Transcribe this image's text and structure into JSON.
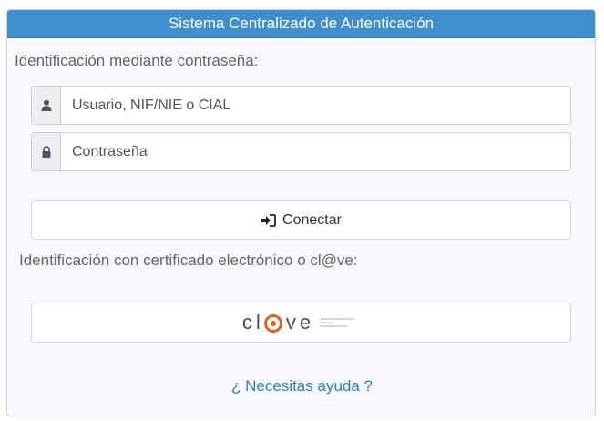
{
  "header": {
    "title": "Sistema Centralizado de Autenticación"
  },
  "password_section": {
    "label": "Identificación mediante contraseña:",
    "user_field": {
      "placeholder": "Usuario, NIF/NIE o CIAL",
      "value": "",
      "icon": "user-icon"
    },
    "password_field": {
      "placeholder": "Contraseña",
      "value": "",
      "icon": "lock-icon"
    },
    "connect_button": {
      "label": "Conectar",
      "icon": "sign-in-icon"
    }
  },
  "certificate_section": {
    "label": "Identificación con certificado electrónico o cl@ve:",
    "clave_logo": {
      "text_left": "cl",
      "text_right": "ve",
      "tagline": "Identidad electrónica para las administraciones",
      "accent_color": "#e8621c"
    }
  },
  "help": {
    "label": "¿ Necesitas ayuda ?"
  },
  "colors": {
    "header_bg": "#3f8fce",
    "link": "#2f7fc0",
    "panel_bg": "#f6f8fb"
  }
}
